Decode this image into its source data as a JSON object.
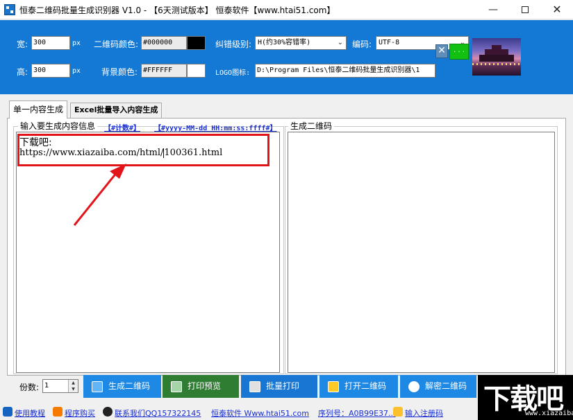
{
  "window": {
    "title": "恒泰二维码批量生成识别器 V1.0 - 【6天测试版本】 恒泰软件【www.htai51.com】",
    "controls": {
      "minimize": "—",
      "close": "✕"
    }
  },
  "settings": {
    "width_label": "宽:",
    "width_value": "300",
    "width_unit": "px",
    "height_label": "高:",
    "height_value": "300",
    "height_unit": "px",
    "qr_color_label": "二维码颜色:",
    "qr_color_value": "#000000",
    "qr_color_swatch": "#000000",
    "bg_color_label": "背景颜色:",
    "bg_color_value": "#FFFFFF",
    "bg_color_swatch": "#FFFFFF",
    "ec_label": "纠错级别:",
    "ec_value": "H(约30%容错率)",
    "encoding_label": "编码:",
    "encoding_value": "UTF-8",
    "logo_label": "LOGO图标:",
    "logo_path": "D:\\Program Files\\恒泰二维码批量生成识别器\\1",
    "logo_browse_label": ". . ."
  },
  "tabs": [
    {
      "label": "单一内容生成",
      "active": true
    },
    {
      "label": "Excel批量导入内容生成",
      "active": false
    }
  ],
  "input_panel": {
    "title": "输入要生成内容信息",
    "insert_counter": "【#计数#】",
    "insert_datetime": "【#yyyy-MM-dd HH:mm:ss:ffff#】",
    "content_line1": "下载吧:",
    "content_line2_before_caret": "https://www.xiazaiba.com/html/",
    "content_line2_after_caret": "100361.html"
  },
  "output_panel": {
    "title": "生成二维码"
  },
  "toolbar": {
    "copies_label": "份数:",
    "copies_value": "1",
    "buttons": [
      {
        "label": "生成二维码",
        "color": "#1e88e5"
      },
      {
        "label": "打印预览",
        "color": "#2e7d32"
      },
      {
        "label": "批量打印",
        "color": "#1976d2"
      },
      {
        "label": "打开二维码",
        "color": "#1e88e5"
      },
      {
        "label": "解密二维码",
        "color": "#1e88e5"
      }
    ]
  },
  "statusbar": {
    "help": "使用教程",
    "buy": "程序购买",
    "contact": "联系我们QQ157322145",
    "website": "恒泰软件 Www.htai51.com",
    "serial": "序列号：A0B99E37...",
    "register": "输入注册码"
  },
  "annotation": {
    "highlight_color": "#e2141a"
  },
  "watermark": {
    "main": "下载吧",
    "sub": "www.xiazaiba.com"
  }
}
